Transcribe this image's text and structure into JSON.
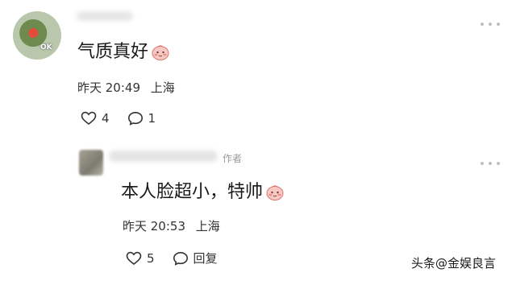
{
  "comment1": {
    "avatar_tag": "OK",
    "text": "气质真好",
    "emoji": "blush-face-icon",
    "time": "昨天 20:49",
    "location": "上海",
    "like_count": "4",
    "reply_count": "1"
  },
  "reply1": {
    "author_tag": "作者",
    "text": "本人脸超小，特帅",
    "emoji": "blush-face-icon",
    "time": "昨天 20:53",
    "location": "上海",
    "like_count": "5",
    "reply_label": "回复"
  },
  "watermark": {
    "text": "头条@金娱良言"
  }
}
